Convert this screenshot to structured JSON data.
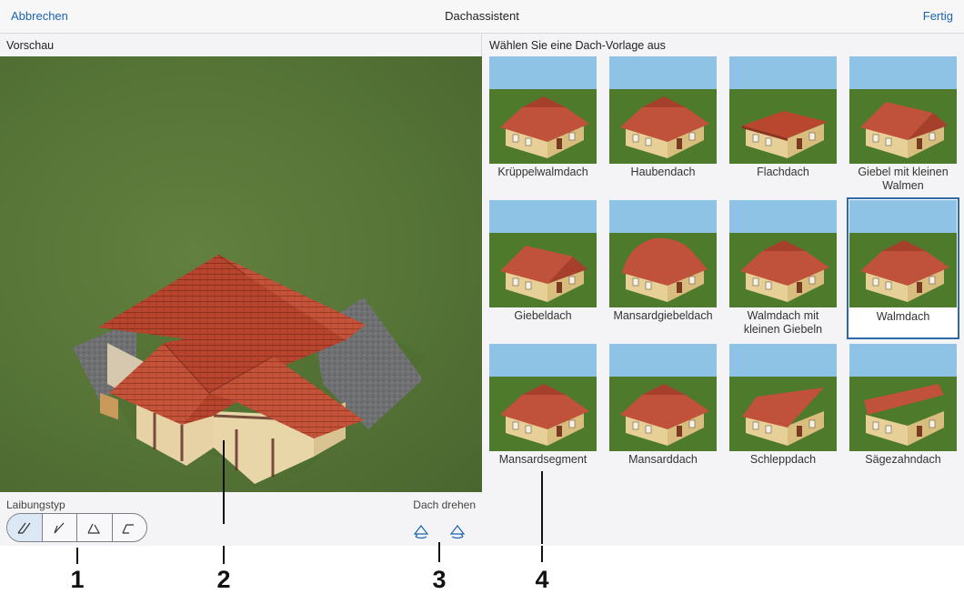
{
  "topbar": {
    "cancel_label": "Abbrechen",
    "title": "Dachassistent",
    "done_label": "Fertig"
  },
  "preview": {
    "header": "Vorschau"
  },
  "controls": {
    "reveal_type_label": "Laibungstyp",
    "rotate_label": "Dach drehen",
    "reveal_options": [
      "reveal-type-1-icon",
      "reveal-type-2-icon",
      "reveal-type-3-icon",
      "reveal-type-4-icon"
    ],
    "selected_reveal": 0,
    "rotate_icons": [
      "rotate-left-icon",
      "rotate-right-icon"
    ]
  },
  "templates": {
    "header": "Wählen Sie eine Dach-Vorlage aus",
    "selected": 7,
    "items": [
      {
        "label": "Krüppelwalmdach",
        "roof": "hip-clipped"
      },
      {
        "label": "Haubendach",
        "roof": "hood"
      },
      {
        "label": "Flachdach",
        "roof": "flat"
      },
      {
        "label": "Giebel mit kleinen Walmen",
        "roof": "gable-small-hips"
      },
      {
        "label": "Giebeldach",
        "roof": "gable"
      },
      {
        "label": "Mansardgiebeldach",
        "roof": "mansard-gable"
      },
      {
        "label": "Walmdach mit kleinen Giebeln",
        "roof": "hip-small-gables"
      },
      {
        "label": "Walmdach",
        "roof": "hip"
      },
      {
        "label": "Mansardsegment",
        "roof": "mansard-segment"
      },
      {
        "label": "Mansarddach",
        "roof": "mansard"
      },
      {
        "label": "Schleppdach",
        "roof": "lean-to"
      },
      {
        "label": "Sägezahndach",
        "roof": "sawtooth"
      }
    ]
  },
  "callouts": [
    "1",
    "2",
    "3",
    "4"
  ],
  "colors": {
    "accent": "#1a64b4",
    "selection": "#2e6aa7",
    "roof": "#b5452f",
    "wall": "#e9d59a",
    "grass": "#4e7a2c",
    "sky": "#8fc3e6"
  }
}
